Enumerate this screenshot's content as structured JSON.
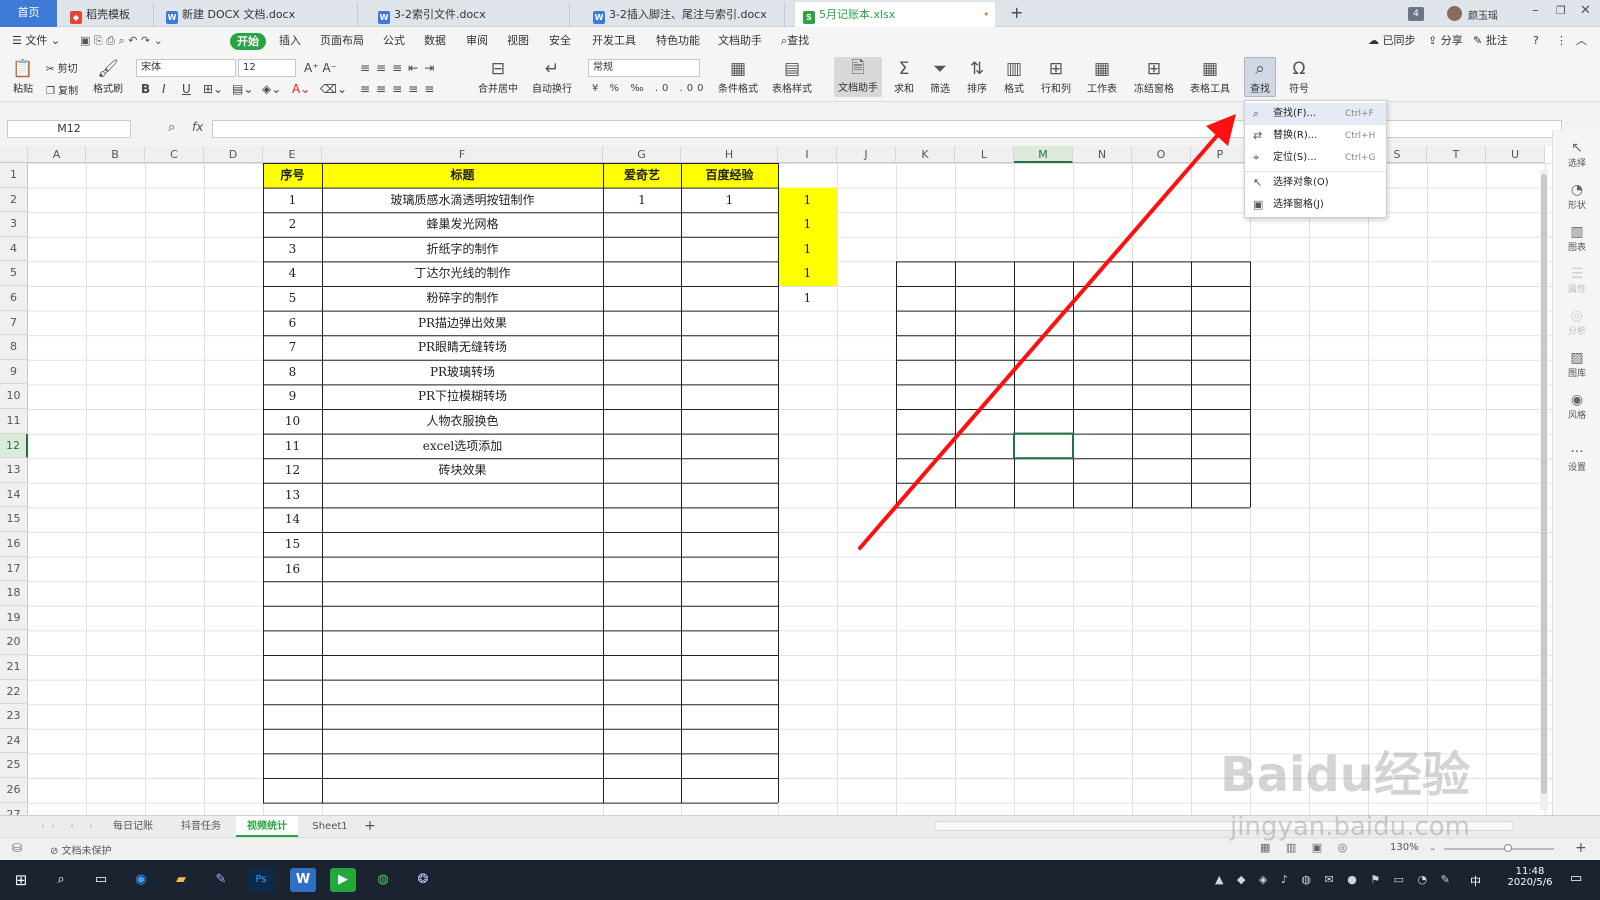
{
  "tabs": {
    "home": "首页",
    "t1": "稻壳模板",
    "t2": "新建 DOCX 文档.docx",
    "t3": "3-2索引文件.docx",
    "t4": "3-2插入脚注、尾注与索引.docx",
    "t5": "5月记账本.xlsx",
    "badge": "4",
    "user": "颜玉瑶"
  },
  "menu": {
    "file": "文件",
    "start": "开始",
    "insert": "插入",
    "layout": "页面布局",
    "formula": "公式",
    "data": "数据",
    "review": "审阅",
    "view": "视图",
    "security": "安全",
    "dev": "开发工具",
    "special": "特色功能",
    "dochelper": "文档助手",
    "find": "查找",
    "synced": "已同步",
    "share": "分享",
    "comment": "批注"
  },
  "toolbar": {
    "paste": "粘贴",
    "cut": "剪切",
    "copy": "复制",
    "format_painter": "格式刷",
    "font": "宋体",
    "size": "12",
    "merge": "合并居中",
    "wrap": "自动换行",
    "numfmt": "常规",
    "cond": "条件格式",
    "tablestyle": "表格样式",
    "dochelper": "文档助手",
    "sum": "求和",
    "filter": "筛选",
    "sort": "排序",
    "format": "格式",
    "rowcol": "行和列",
    "sheet": "工作表",
    "freeze": "冻结窗格",
    "tabletool": "表格工具",
    "find": "查找",
    "symbol": "符号"
  },
  "formula": {
    "cellref": "M12",
    "fx": "fx"
  },
  "columns": [
    "A",
    "B",
    "C",
    "D",
    "E",
    "F",
    "G",
    "H",
    "I",
    "J",
    "K",
    "L",
    "M",
    "N",
    "O",
    "P",
    "S",
    "T",
    "U"
  ],
  "rows": [
    "1",
    "2",
    "3",
    "4",
    "5",
    "6",
    "7",
    "8",
    "9",
    "10",
    "11",
    "12",
    "13",
    "14",
    "15",
    "16",
    "17",
    "18",
    "19",
    "20",
    "21",
    "22",
    "23",
    "24",
    "25",
    "26",
    "27"
  ],
  "table": {
    "headers": [
      "序号",
      "标题",
      "爱奇艺",
      "百度经验"
    ],
    "nums": [
      "1",
      "2",
      "3",
      "4",
      "5",
      "6",
      "7",
      "8",
      "9",
      "10",
      "11",
      "12",
      "13",
      "14",
      "15",
      "16"
    ],
    "titles": [
      "玻璃质感水滴透明按钮制作",
      "蜂巢发光网格",
      "折纸字的制作",
      "丁达尔光线的制作",
      "粉碎字的制作",
      "PR描边弹出效果",
      "PR眼睛无缝转场",
      "PR玻璃转场",
      "PR下拉模糊转场",
      "人物衣服换色",
      "excel选项添加",
      "砖块效果"
    ],
    "g2": "1",
    "h2": "1",
    "col_i": [
      "1",
      "1",
      "1",
      "1",
      "1"
    ]
  },
  "dropdown": [
    {
      "label": "查找(F)...",
      "key": "Ctrl+F",
      "icon": "search-icon"
    },
    {
      "label": "替换(R)...",
      "key": "Ctrl+H",
      "icon": "replace-icon"
    },
    {
      "label": "定位(S)...",
      "key": "Ctrl+G",
      "icon": "locate-icon"
    },
    {
      "label": "选择对象(O)",
      "key": "",
      "icon": "pointer-icon"
    },
    {
      "label": "选择窗格(J)",
      "key": "",
      "icon": "pane-icon"
    }
  ],
  "rpanel": {
    "select": "选择",
    "shape": "形状",
    "chart": "图表",
    "prop": "属性",
    "analyze": "分析",
    "gallery": "图库",
    "style": "风格",
    "settings": "设置"
  },
  "sheets": {
    "s1": "每日记账",
    "s2": "抖音任务",
    "s3": "视频统计",
    "s4": "Sheet1"
  },
  "status": {
    "protect": "文档未保护",
    "zoom": "130%"
  },
  "taskbar": {
    "time": "11:48",
    "date": "2020/5/6",
    "ime": "中"
  },
  "watermark": {
    "brand": "Baidu经验",
    "url": "jingyan.baidu.com"
  },
  "colors": {
    "header_fill": "#ffff00",
    "accent_green": "#2aa343",
    "arrow": "#ff0000",
    "selected_cell": "#217346"
  }
}
